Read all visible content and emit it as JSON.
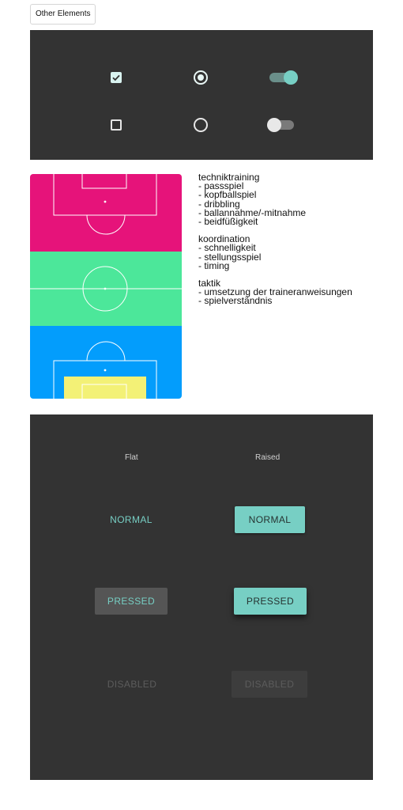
{
  "header": {
    "button_label": "Other Elements"
  },
  "controls": {
    "checkbox_checked": true,
    "checkbox_unchecked": false,
    "radio_selected": true,
    "radio_unselected": false,
    "toggle_on": true,
    "toggle_off": false,
    "accent": "#77cfc4"
  },
  "pitch": {
    "colors": {
      "top": "#e6137a",
      "middle": "#4ce79a",
      "bottom": "#039dfc",
      "highlight": "#f3f176"
    }
  },
  "notes": {
    "groups": [
      {
        "title": "techniktraining",
        "items": [
          "- passspiel",
          "- kopfballspiel",
          "- dribbling",
          "- ballannahme/-mitnahme",
          "- beidfüßigkeit"
        ]
      },
      {
        "title": "koordination",
        "items": [
          "- schnelligkeit",
          "- stellungsspiel",
          "- timing"
        ]
      },
      {
        "title": "taktik",
        "items": [
          "- umsetzung der traineranweisungen",
          "- spielverständnis"
        ]
      }
    ]
  },
  "buttons": {
    "flat_header": "Flat",
    "raised_header": "Raised",
    "flat": {
      "normal": "NORMAL",
      "pressed": "PRESSED",
      "disabled": "DISABLED"
    },
    "raised": {
      "normal": "NORMAL",
      "pressed": "PRESSED",
      "disabled": "DISABLED"
    },
    "colors": {
      "accent": "#77cfc4",
      "panel": "#333333"
    }
  }
}
